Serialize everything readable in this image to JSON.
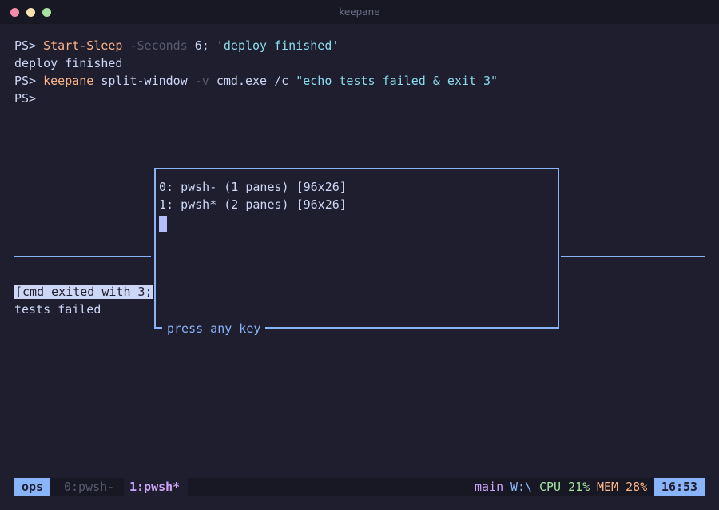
{
  "window": {
    "title": "keepane"
  },
  "top_pane": {
    "lines": [
      {
        "prompt": "PS> ",
        "cmd": "Start-Sleep",
        "param": " -Seconds",
        "arg": " 6;",
        "str": " 'deploy finished'"
      },
      {
        "text": "deploy finished"
      },
      {
        "prompt": "PS> ",
        "cmd": "keepane",
        "rest1": " split-window ",
        "param": "-v",
        "rest2": " cmd.exe /c ",
        "str": "\"echo tests failed & exit 3\""
      },
      {
        "prompt": "PS>"
      }
    ]
  },
  "bottom_pane": {
    "exit_banner": "[cmd exited with 3;",
    "output": "tests failed"
  },
  "popup": {
    "rows": [
      "0: pwsh- (1 panes) [96x26]",
      "1: pwsh* (2 panes) [96x26]"
    ],
    "footer": "press any key"
  },
  "statusbar": {
    "session": "ops",
    "tabs": [
      {
        "label": "0:pwsh-"
      },
      {
        "label": "1:pwsh*"
      }
    ],
    "branch": "main",
    "path": "W:\\",
    "cpu": "CPU 21%",
    "mem": "MEM 28%",
    "clock": "16:53"
  },
  "colors": {
    "background": "#1e1e2e",
    "accent": "#89b4fa",
    "command": "#fab387",
    "string": "#89dceb"
  }
}
